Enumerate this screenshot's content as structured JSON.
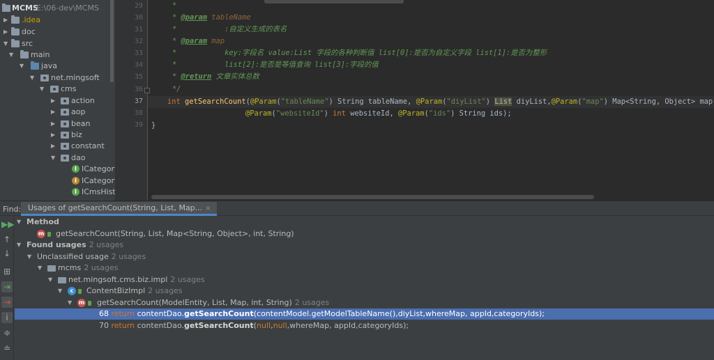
{
  "project_tree": {
    "root_name": "MCMS",
    "root_path": "E:\\06-dev\\MCMS",
    "items": [
      {
        "label": ".idea",
        "icon": "folder-icon"
      },
      {
        "label": "doc",
        "icon": "folder-icon"
      },
      {
        "label": "src",
        "icon": "folder-icon"
      },
      {
        "label": "main",
        "icon": "folder-icon"
      },
      {
        "label": "java",
        "icon": "source-folder-icon"
      },
      {
        "label": "net.mingsoft",
        "icon": "package-icon"
      },
      {
        "label": "cms",
        "icon": "package-icon"
      },
      {
        "label": "action",
        "icon": "package-icon"
      },
      {
        "label": "aop",
        "icon": "package-icon"
      },
      {
        "label": "bean",
        "icon": "package-icon"
      },
      {
        "label": "biz",
        "icon": "package-icon"
      },
      {
        "label": "constant",
        "icon": "package-icon"
      },
      {
        "label": "dao",
        "icon": "package-icon"
      },
      {
        "label": "ICategory",
        "icon": "interface-icon"
      },
      {
        "label": "ICategory",
        "icon": "interface-icon"
      },
      {
        "label": "ICmsHisto",
        "icon": "interface-icon"
      }
    ]
  },
  "editor": {
    "line_numbers": [
      "29",
      "30",
      "31",
      "32",
      "33",
      "34",
      "35",
      "36",
      "37",
      "38",
      "39"
    ],
    "doc": {
      "l29_star": "*",
      "l30_star": "* ",
      "l30_tag": "@param",
      "l30_name": " tableName",
      "l31_text": "*           :自定义生成的表名",
      "l32_star": "* ",
      "l32_tag": "@param",
      "l32_name": " map",
      "l33_text": "*           key:字段名 value:List 字段的各种判断值 list[0]:是否为自定义字段 list[1]:是否为整形",
      "l34_text": "*           list[2]:是否是等值查询 list[3]:字段的值",
      "l35_star": "* ",
      "l35_tag": "@return",
      "l35_text": " 文章实体总数",
      "l36_text": "*/"
    },
    "l37": {
      "kw_int": "int",
      "fn": "getSearchCount",
      "p1": "(",
      "a1": "@Param",
      "s1": "\"tableName\"",
      "t1": ") String tableName, ",
      "a2": "@Param",
      "p2": "(",
      "s2": "\"diyList\"",
      "t2": ") ",
      "hl": "List",
      "t3": " diyList,",
      "a3": "@Param",
      "p3": "(",
      "s3": "\"map\"",
      "t4": ") Map<String, Object> map,"
    },
    "l38": {
      "a1": "@Param",
      "p1": "(",
      "s1": "\"websiteId\"",
      "t1": ") ",
      "kw_int": "int",
      "t2": " websiteId, ",
      "a2": "@Param",
      "p2": "(",
      "s2": "\"ids\"",
      "t3": ") String ids);"
    },
    "l39": "}"
  },
  "find_panel": {
    "label": "Find:",
    "tab_title": "Usages of getSearchCount(String, List, Map...",
    "tab_close": "×",
    "tree": {
      "method_header": "Method",
      "method_sig": "getSearchCount(String, List, Map<String, Object>, int, String)",
      "found_usages": "Found usages",
      "found_count": "2 usages",
      "unclassified": "Unclassified usage",
      "unclassified_count": "2 usages",
      "module": "mcms",
      "module_count": "2 usages",
      "package": "net.mingsoft.cms.biz.impl",
      "package_count": "2 usages",
      "class": "ContentBizImpl",
      "class_count": "2 usages",
      "caller": "getSearchCount(ModelEntity, List, Map, int, String)",
      "caller_count": "2 usages",
      "usage1_line": "68",
      "usage1_return": "return",
      "usage1_pre": " contentDao.",
      "usage1_fn": "getSearchCount",
      "usage1_args": "(contentModel.getModelTableName(),diyList,whereMap, appId,categoryIds);",
      "usage2_line": "70",
      "usage2_return": "return",
      "usage2_pre": " contentDao.",
      "usage2_fn": "getSearchCount",
      "usage2_open": "(",
      "usage2_null1": "null",
      "usage2_comma": ",",
      "usage2_null2": "null",
      "usage2_args": ",whereMap, appId,categoryIds);"
    }
  }
}
